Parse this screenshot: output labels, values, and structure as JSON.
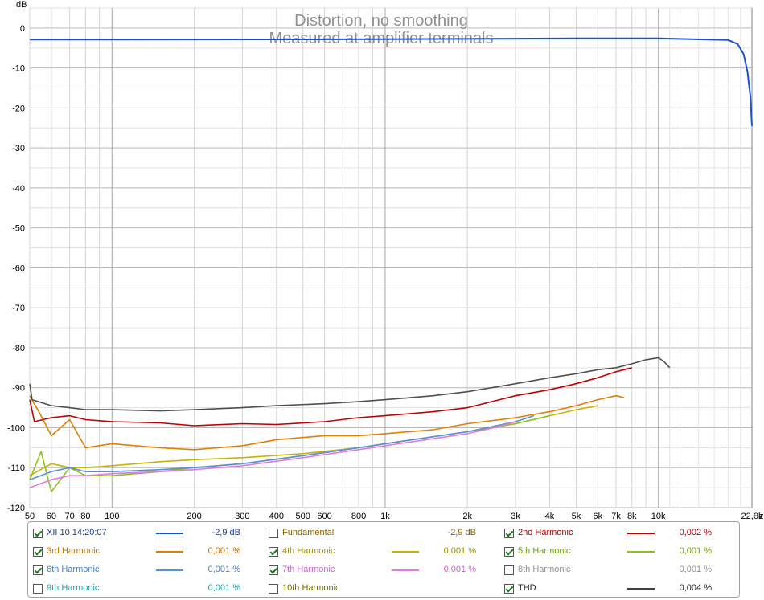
{
  "chart_data": {
    "type": "line",
    "title": "Distortion, no smoothing",
    "subtitle": "Measured at amplifier terminals",
    "ylabel": "dB",
    "xunit": "Hz",
    "xscale": "log",
    "xlim": [
      50,
      22000
    ],
    "ylim": [
      -120,
      5
    ],
    "grid": true,
    "y_ticks": [
      0,
      -10,
      -20,
      -30,
      -40,
      -50,
      -60,
      -70,
      -80,
      -90,
      -100,
      -110,
      -120
    ],
    "x_ticks": [
      {
        "v": 50,
        "label": "50"
      },
      {
        "v": 60,
        "label": "60"
      },
      {
        "v": 70,
        "label": "70"
      },
      {
        "v": 80,
        "label": "80"
      },
      {
        "v": 100,
        "label": "100"
      },
      {
        "v": 200,
        "label": "200"
      },
      {
        "v": 300,
        "label": "300"
      },
      {
        "v": 400,
        "label": "400"
      },
      {
        "v": 500,
        "label": "500"
      },
      {
        "v": 600,
        "label": "600"
      },
      {
        "v": 800,
        "label": "800"
      },
      {
        "v": 1000,
        "label": "1k"
      },
      {
        "v": 2000,
        "label": "2k"
      },
      {
        "v": 3000,
        "label": "3k"
      },
      {
        "v": 4000,
        "label": "4k"
      },
      {
        "v": 5000,
        "label": "5k"
      },
      {
        "v": 6000,
        "label": "6k"
      },
      {
        "v": 7000,
        "label": "7k"
      },
      {
        "v": 8000,
        "label": "8k"
      },
      {
        "v": 10000,
        "label": "10k"
      },
      {
        "v": 22000,
        "label": "22,0k"
      }
    ],
    "series": [
      {
        "name": "XII 10 14:20:07",
        "color": "#1a4fd8",
        "x": [
          50,
          100,
          1000,
          5000,
          10000,
          18000,
          19500,
          20500,
          21200,
          21700,
          22000
        ],
        "y": [
          -2.9,
          -2.9,
          -2.8,
          -2.6,
          -2.6,
          -3.0,
          -4.0,
          -6.5,
          -11,
          -17,
          -24.5
        ]
      },
      {
        "name": "2nd Harmonic",
        "color": "#c00000",
        "x": [
          50,
          52,
          60,
          70,
          80,
          100,
          150,
          200,
          300,
          400,
          600,
          800,
          1000,
          1500,
          2000,
          3000,
          4000,
          5000,
          6000,
          7000,
          8000
        ],
        "y": [
          -93,
          -98.5,
          -97.5,
          -97,
          -98,
          -98.5,
          -98.8,
          -99.5,
          -99,
          -99.2,
          -98.5,
          -97.5,
          -97,
          -96,
          -95,
          -92,
          -90.5,
          -89,
          -87.5,
          -86,
          -85
        ]
      },
      {
        "name": "3rd Harmonic",
        "color": "#e08000",
        "x": [
          50,
          55,
          60,
          70,
          80,
          100,
          150,
          200,
          300,
          400,
          600,
          800,
          1000,
          1500,
          2000,
          3000,
          4000,
          5000,
          6000,
          7000,
          7500
        ],
        "y": [
          -92,
          -97,
          -102,
          -98,
          -105,
          -104,
          -105,
          -105.5,
          -104.5,
          -103,
          -102,
          -102,
          -101.5,
          -100.5,
          -99,
          -97.5,
          -96,
          -94.5,
          -93,
          -92,
          -92.5
        ]
      },
      {
        "name": "4th Harmonic",
        "color": "#c8b400",
        "x": [
          50,
          60,
          70,
          80,
          100,
          150,
          200,
          300,
          500,
          800,
          1000,
          2000,
          3000,
          4000,
          5000,
          6000
        ],
        "y": [
          -112,
          -109,
          -110,
          -110,
          -109.5,
          -108.5,
          -108,
          -107.5,
          -106.5,
          -105,
          -104,
          -101,
          -99,
          -97,
          -95.5,
          -94.5
        ]
      },
      {
        "name": "5th Harmonic",
        "color": "#8cc21e",
        "x": [
          50,
          55,
          60,
          70,
          80,
          100,
          150,
          200,
          300,
          500,
          800,
          1000,
          2000,
          3000,
          4000
        ],
        "y": [
          -113,
          -106,
          -116,
          -110,
          -112,
          -112,
          -111,
          -110,
          -109,
          -107,
          -105,
          -104,
          -101,
          -99,
          -97
        ]
      },
      {
        "name": "6th Harmonic",
        "color": "#5a8fdc",
        "x": [
          50,
          60,
          70,
          80,
          100,
          150,
          200,
          300,
          500,
          800,
          1000,
          2000,
          3000,
          3500
        ],
        "y": [
          -113,
          -111,
          -110,
          -111,
          -111,
          -110.5,
          -110,
          -109,
          -107,
          -105,
          -104,
          -101,
          -98.5,
          -97
        ]
      },
      {
        "name": "7th Harmonic",
        "color": "#e07ae0",
        "x": [
          50,
          60,
          70,
          80,
          100,
          150,
          200,
          300,
          500,
          800,
          1000,
          2000,
          2500,
          3000
        ],
        "y": [
          -115,
          -113,
          -112,
          -112,
          -111.5,
          -111,
          -110.5,
          -109.5,
          -107.5,
          -105.5,
          -104.5,
          -101.5,
          -100,
          -98.5
        ]
      },
      {
        "name": "THD",
        "color": "#505050",
        "x": [
          50,
          51,
          60,
          70,
          80,
          100,
          150,
          200,
          300,
          400,
          600,
          800,
          1000,
          1500,
          2000,
          3000,
          4000,
          5000,
          6000,
          7000,
          8000,
          9000,
          10000,
          10500,
          11000
        ],
        "y": [
          -89,
          -93,
          -94.5,
          -95,
          -95.5,
          -95.5,
          -95.8,
          -95.5,
          -95,
          -94.5,
          -94,
          -93.5,
          -93,
          -92,
          -91,
          -89,
          -87.5,
          -86.5,
          -85.5,
          -85,
          -84,
          -83,
          -82.5,
          -83.5,
          -85
        ]
      }
    ]
  },
  "legend": [
    {
      "name": "XII 10 14:20:07",
      "value": "-2,9 dB",
      "checked": true,
      "color": "#1a4fd8",
      "textColor": "#1a3ea0"
    },
    {
      "name": "Fundamental",
      "value": "-2,9 dB",
      "checked": false,
      "color": "",
      "textColor": "#806000"
    },
    {
      "name": "2nd Harmonic",
      "value": "0,002 %",
      "checked": true,
      "color": "#c00000",
      "textColor": "#b00000"
    },
    {
      "name": "3rd Harmonic",
      "value": "0,001 %",
      "checked": true,
      "color": "#e08000",
      "textColor": "#c07000"
    },
    {
      "name": "4th Harmonic",
      "value": "0,001 %",
      "checked": true,
      "color": "#c8b400",
      "textColor": "#a09000"
    },
    {
      "name": "5th Harmonic",
      "value": "0,001 %",
      "checked": true,
      "color": "#8cc21e",
      "textColor": "#70a010"
    },
    {
      "name": "6th Harmonic",
      "value": "0,001 %",
      "checked": true,
      "color": "#5a8fdc",
      "textColor": "#4a7ac0"
    },
    {
      "name": "7th Harmonic",
      "value": "0,001 %",
      "checked": true,
      "color": "#e07ae0",
      "textColor": "#d060d0"
    },
    {
      "name": "8th Harmonic",
      "value": "0,001 %",
      "checked": false,
      "color": "",
      "textColor": "#909090"
    },
    {
      "name": "9th Harmonic",
      "value": "0,001 %",
      "checked": false,
      "color": "",
      "textColor": "#20a0a0"
    },
    {
      "name": "10th Harmonic",
      "value": "",
      "checked": false,
      "color": "",
      "textColor": "#707000"
    },
    {
      "name": "THD",
      "value": "0,004 %",
      "checked": true,
      "color": "#404040",
      "textColor": "#202020"
    }
  ]
}
